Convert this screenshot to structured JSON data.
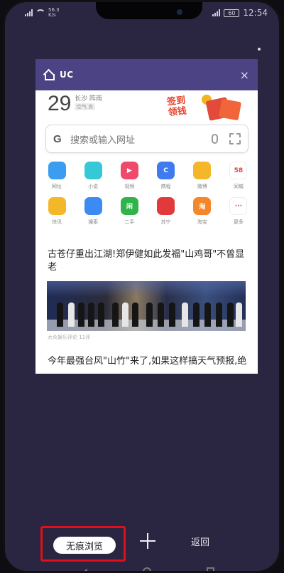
{
  "status": {
    "net_speed_value": "56.3",
    "net_speed_unit": "K/s",
    "battery": "60",
    "time": "12:54"
  },
  "card": {
    "title": "UC",
    "close_symbol": "×",
    "weather": {
      "temp": "29",
      "city": "长沙 阵雨",
      "air": "空气 良"
    },
    "promo": {
      "line1": "签到",
      "line2": "领钱"
    },
    "search": {
      "google_glyph": "G",
      "placeholder": "搜索或输入网址"
    },
    "apps_row1": [
      {
        "label": "网址",
        "color": "#3a9df0",
        "glyph": ""
      },
      {
        "label": "小说",
        "color": "#35c9d8",
        "glyph": ""
      },
      {
        "label": "视频",
        "color": "#ef4a6a",
        "glyph": "▶"
      },
      {
        "label": "携程",
        "color": "#3f7af0",
        "glyph": "C"
      },
      {
        "label": "微博",
        "color": "#f5b72a",
        "glyph": ""
      },
      {
        "label": "同城",
        "color": "#ffffff",
        "glyph": "58"
      }
    ],
    "apps_row2": [
      {
        "label": "快讯",
        "color": "#f5b72a",
        "glyph": ""
      },
      {
        "label": "搜索",
        "color": "#3b8bf2",
        "glyph": ""
      },
      {
        "label": "二手",
        "color": "#2fb34a",
        "glyph": "闲"
      },
      {
        "label": "苏宁",
        "color": "#e23a3a",
        "glyph": ""
      },
      {
        "label": "淘宝",
        "color": "#f5872a",
        "glyph": "淘"
      },
      {
        "label": "更多",
        "color": "#ffffff",
        "glyph": "···"
      }
    ],
    "news1": "古苍仔重出江湖!郑伊健如此发福\"山鸡哥\"不曾显老",
    "news_meta": "大众娱乐评论   11评",
    "news2": "今年最强台风\"山竹\"来了,如果这样搞天气预报,绝"
  },
  "bottom": {
    "incognito": "无痕浏览",
    "back": "返回"
  }
}
